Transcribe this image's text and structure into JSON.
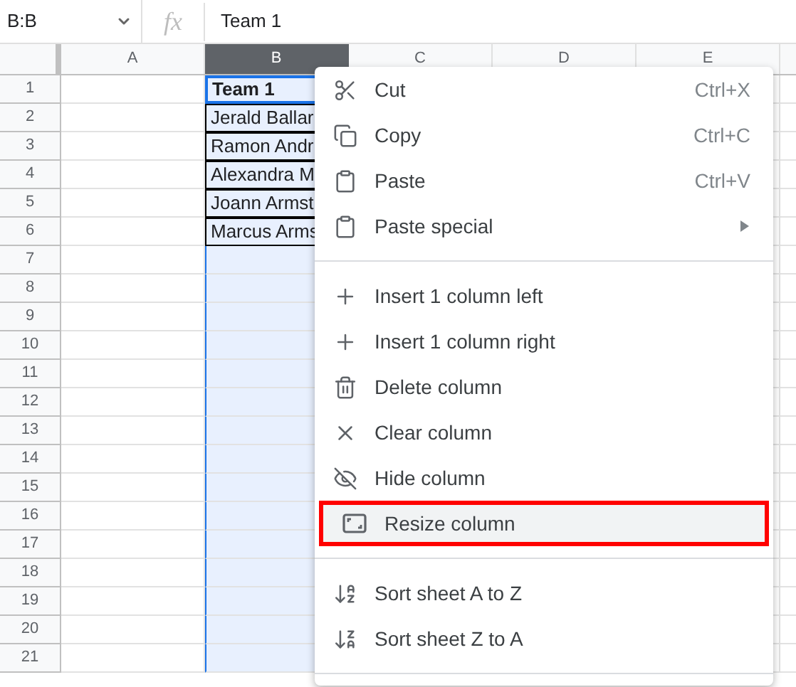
{
  "formula_bar": {
    "name_box": "B:B",
    "fx": "fx",
    "value": "Team 1"
  },
  "columns": [
    {
      "label": "A",
      "selected": false
    },
    {
      "label": "B",
      "selected": true
    },
    {
      "label": "C",
      "selected": false
    },
    {
      "label": "D",
      "selected": false
    },
    {
      "label": "E",
      "selected": false
    }
  ],
  "rows": [
    {
      "number": "1",
      "b": "Team 1",
      "active": true
    },
    {
      "number": "2",
      "b": "Jerald Ballar",
      "active": false,
      "bordered": true
    },
    {
      "number": "3",
      "b": "Ramon Andr",
      "active": false,
      "bordered": true
    },
    {
      "number": "4",
      "b": "Alexandra M",
      "active": false,
      "bordered": true
    },
    {
      "number": "5",
      "b": "Joann Armst",
      "active": false,
      "bordered": true
    },
    {
      "number": "6",
      "b": "Marcus Arms",
      "active": false,
      "bordered": true
    },
    {
      "number": "7",
      "active": false,
      "bordered": false
    },
    {
      "number": "8",
      "active": false,
      "bordered": false
    },
    {
      "number": "9",
      "active": false,
      "bordered": false
    },
    {
      "number": "10",
      "active": false,
      "bordered": false
    },
    {
      "number": "11",
      "active": false,
      "bordered": false
    },
    {
      "number": "12",
      "active": false,
      "bordered": false
    },
    {
      "number": "13",
      "active": false,
      "bordered": false
    },
    {
      "number": "14",
      "active": false,
      "bordered": false
    },
    {
      "number": "15",
      "active": false,
      "bordered": false
    },
    {
      "number": "16",
      "active": false,
      "bordered": false
    },
    {
      "number": "17",
      "active": false,
      "bordered": false
    },
    {
      "number": "18",
      "active": false,
      "bordered": false
    },
    {
      "number": "19",
      "active": false,
      "bordered": false
    },
    {
      "number": "20",
      "active": false,
      "bordered": false
    },
    {
      "number": "21",
      "active": false,
      "bordered": false
    }
  ],
  "context_menu": [
    {
      "kind": "action",
      "label": "Cut",
      "shortcut": "Ctrl+X",
      "submenu": false,
      "hover": false,
      "highlighted": false
    },
    {
      "kind": "action",
      "label": "Copy",
      "shortcut": "Ctrl+C",
      "submenu": false,
      "hover": false,
      "highlighted": false
    },
    {
      "kind": "action",
      "label": "Paste",
      "shortcut": "Ctrl+V",
      "submenu": false,
      "hover": false,
      "highlighted": false
    },
    {
      "kind": "action",
      "label": "Paste special",
      "submenu": true,
      "hover": false,
      "highlighted": false
    },
    {
      "kind": "divider"
    },
    {
      "kind": "action",
      "label": "Insert 1 column left",
      "submenu": false,
      "hover": false,
      "highlighted": false
    },
    {
      "kind": "action",
      "label": "Insert 1 column right",
      "submenu": false,
      "hover": false,
      "highlighted": false
    },
    {
      "kind": "action",
      "label": "Delete column",
      "submenu": false,
      "hover": false,
      "highlighted": false
    },
    {
      "kind": "action",
      "label": "Clear column",
      "submenu": false,
      "hover": false,
      "highlighted": false
    },
    {
      "kind": "action",
      "label": "Hide column",
      "submenu": false,
      "hover": false,
      "highlighted": false
    },
    {
      "kind": "action",
      "label": "Resize column",
      "submenu": false,
      "hover": true,
      "highlighted": true
    },
    {
      "kind": "divider"
    },
    {
      "kind": "action",
      "label": "Sort sheet A to Z",
      "submenu": false,
      "hover": false,
      "highlighted": false
    },
    {
      "kind": "action",
      "label": "Sort sheet Z to A",
      "submenu": false,
      "hover": false,
      "highlighted": false
    },
    {
      "kind": "divider"
    }
  ]
}
